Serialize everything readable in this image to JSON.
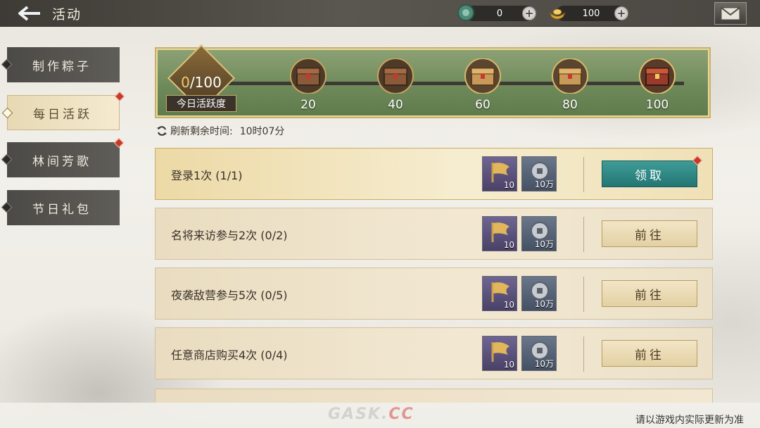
{
  "header": {
    "title": "活动",
    "currencies": [
      {
        "icon": "jade-coin-icon",
        "value": "0"
      },
      {
        "icon": "gold-ingot-icon",
        "value": "100"
      }
    ]
  },
  "sidebar": {
    "items": [
      {
        "label": "制作粽子",
        "active": false,
        "badge": false
      },
      {
        "label": "每日活跃",
        "active": true,
        "badge": true
      },
      {
        "label": "林间芳歌",
        "active": false,
        "badge": true
      },
      {
        "label": "节日礼包",
        "active": false,
        "badge": false
      }
    ]
  },
  "progress": {
    "current": "0",
    "total": "/100",
    "label": "今日活跃度",
    "milestones": [
      "20",
      "40",
      "60",
      "80",
      "100"
    ]
  },
  "refresh": {
    "label": "刷新剩余时间:",
    "time": "10时07分"
  },
  "tasks": [
    {
      "name": "登录1次 (1/1)",
      "rewards": [
        "10",
        "10万"
      ],
      "button": "领取",
      "state": "claim"
    },
    {
      "name": "名将来访参与2次 (0/2)",
      "rewards": [
        "10",
        "10万"
      ],
      "button": "前往",
      "state": "go"
    },
    {
      "name": "夜袭敌营参与5次 (0/5)",
      "rewards": [
        "10",
        "10万"
      ],
      "button": "前往",
      "state": "go"
    },
    {
      "name": "任意商店购买4次 (0/4)",
      "rewards": [
        "10",
        "10万"
      ],
      "button": "前往",
      "state": "go"
    }
  ],
  "footer": {
    "watermark_main": "GASK.",
    "watermark_cc": "CC",
    "note": "请以游戏内实际更新为准"
  },
  "colors": {
    "claim_button": "#2f8a86",
    "go_button": "#ecdcb6",
    "banner_green": "#6f8a5a",
    "badge_red": "#c8382f"
  }
}
